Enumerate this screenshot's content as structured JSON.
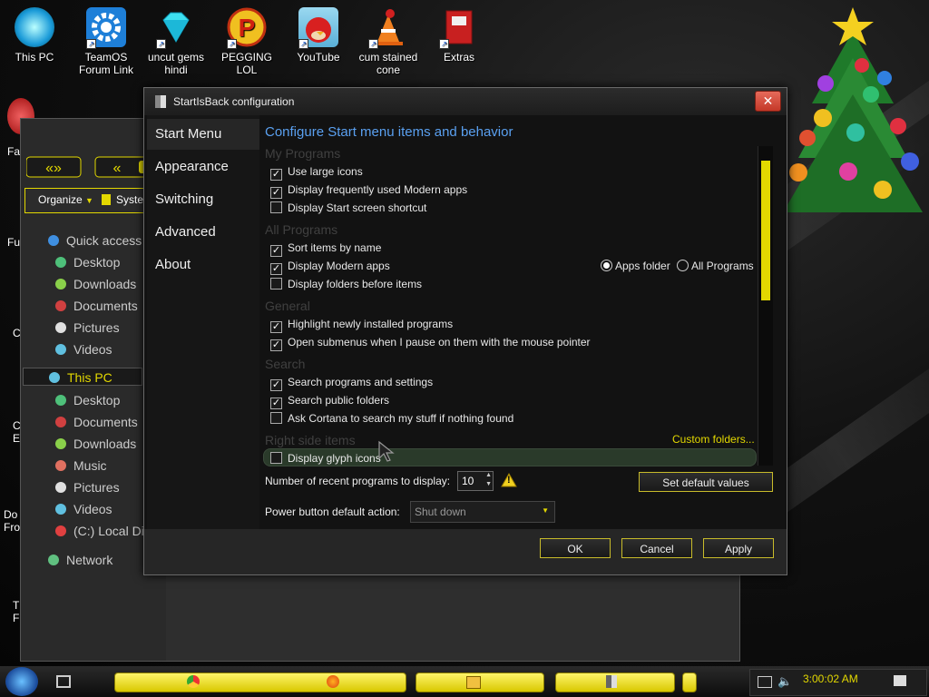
{
  "desktop_icons": [
    {
      "label": "This PC",
      "icon": "monitor-icon"
    },
    {
      "label": "TeamOS Forum Link",
      "icon": "gear-icon"
    },
    {
      "label": "uncut gems hindi",
      "icon": "diamond-icon"
    },
    {
      "label": "PEGGING LOL",
      "icon": "p-logo-icon"
    },
    {
      "label": "YouTube",
      "icon": "angry-bird-icon"
    },
    {
      "label": "cum stained cone",
      "icon": "traffic-cone-icon"
    },
    {
      "label": "Extras",
      "icon": "folder-book-icon"
    }
  ],
  "left_edge_labels": [
    "Fal",
    "Fu",
    "C",
    "C E",
    "Do Fro",
    "T F"
  ],
  "explorer": {
    "toolbar_organize": "Organize",
    "toolbar_system": "Syste",
    "nav": [
      {
        "label": "Quick access",
        "icon": "star-icon",
        "color": "#3f8fe0"
      },
      {
        "label": "Desktop",
        "icon": "desktop-icon",
        "color": "#4ec07a"
      },
      {
        "label": "Downloads",
        "icon": "downloads-icon",
        "color": "#8ad04a"
      },
      {
        "label": "Documents",
        "icon": "documents-icon",
        "color": "#d04040"
      },
      {
        "label": "Pictures",
        "icon": "pictures-icon",
        "color": "#e0e0e0"
      },
      {
        "label": "Videos",
        "icon": "videos-icon",
        "color": "#60c0e0"
      },
      {
        "label": "This PC",
        "icon": "pc-icon",
        "color": "#60c0e0"
      },
      {
        "label": "Desktop",
        "icon": "desktop-icon",
        "color": "#4ec07a"
      },
      {
        "label": "Documents",
        "icon": "documents-icon",
        "color": "#d04040"
      },
      {
        "label": "Downloads",
        "icon": "downloads-icon",
        "color": "#8ad04a"
      },
      {
        "label": "Music",
        "icon": "music-icon",
        "color": "#e07060"
      },
      {
        "label": "Pictures",
        "icon": "pictures-icon",
        "color": "#e0e0e0"
      },
      {
        "label": "Videos",
        "icon": "videos-icon",
        "color": "#60c0e0"
      },
      {
        "label": "(C:) Local Dis",
        "icon": "drive-icon",
        "color": "#e04040"
      },
      {
        "label": "Network",
        "icon": "network-icon",
        "color": "#60c080"
      }
    ]
  },
  "dialog": {
    "title": "StartIsBack configuration",
    "close_glyph": "✕",
    "sidebar": [
      "Start Menu",
      "Appearance",
      "Switching",
      "Advanced",
      "About"
    ],
    "heading": "Configure Start menu items and behavior",
    "sections": {
      "my_programs": "My Programs",
      "all_programs": "All Programs",
      "general": "General",
      "search": "Search",
      "right_side": "Right side items"
    },
    "options": {
      "use_large_icons": {
        "label": "Use large icons",
        "checked": true
      },
      "frequent_modern": {
        "label": "Display frequently used Modern apps",
        "checked": true
      },
      "start_screen_shortcut": {
        "label": "Display Start screen shortcut",
        "checked": false
      },
      "sort_by_name": {
        "label": "Sort items by name",
        "checked": true
      },
      "modern_apps": {
        "label": "Display Modern apps",
        "checked": true
      },
      "folders_before": {
        "label": "Display folders before items",
        "checked": false
      },
      "highlight_new": {
        "label": "Highlight newly installed programs",
        "checked": true
      },
      "open_submenus": {
        "label": "Open submenus when I pause on them with the mouse pointer",
        "checked": true
      },
      "search_programs": {
        "label": "Search programs and settings",
        "checked": true
      },
      "search_public": {
        "label": "Search public folders",
        "checked": true
      },
      "ask_cortana": {
        "label": "Ask Cortana to search my stuff if nothing found",
        "checked": false
      },
      "glyph_icons": {
        "label": "Display glyph icons",
        "checked": false
      }
    },
    "radio": {
      "apps_folder": "Apps folder",
      "all_programs": "All Programs",
      "selected": "apps_folder"
    },
    "custom_folders": "Custom folders...",
    "recent_label": "Number of recent programs to display:",
    "recent_value": "10",
    "warning_glyph": "!",
    "default_values": "Set default values",
    "power_label": "Power button default action:",
    "power_value": "Shut down",
    "ok": "OK",
    "cancel": "Cancel",
    "apply": "Apply"
  },
  "taskbar": {
    "time": "3:00:02 AM"
  },
  "colors": {
    "accent_yellow": "#e3d800",
    "heading_blue": "#5aa0f0",
    "close_red": "#d04030"
  }
}
